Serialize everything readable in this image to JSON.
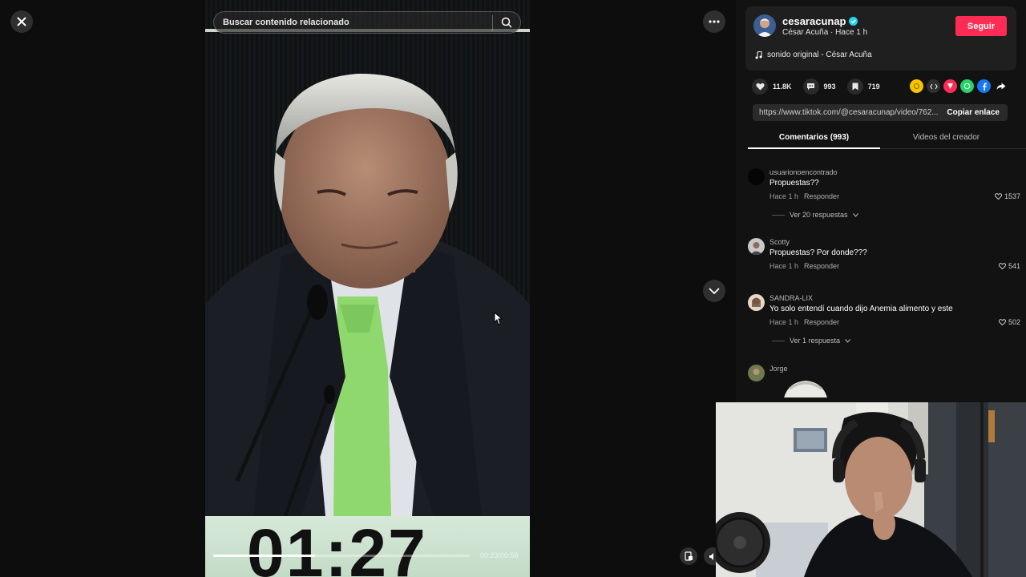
{
  "viewer": {
    "close_icon": "close-icon",
    "more_icon": "more-options-icon",
    "search_placeholder": "Buscar contenido relacionado",
    "scoreboard_time": "01:27",
    "playback_time": "00:23/00:58",
    "progress": 0.397
  },
  "author": {
    "handle": "cesaracunap",
    "display_name": "César Acuña",
    "posted_ago": "Hace 1 h",
    "follow_label": "Seguir",
    "music": "sonido original - César Acuña"
  },
  "actions": {
    "likes": "11.8K",
    "comments": "993",
    "saves": "719"
  },
  "link": {
    "url": "https://www.tiktok.com/@cesaracunap/video/762...",
    "copy_label": "Copiar enlace"
  },
  "tabs": [
    {
      "label": "Comentarios (993)"
    },
    {
      "label": "Videos del creador"
    }
  ],
  "comments": [
    {
      "user": "usuarionoencontrado",
      "text": "Propuestas??",
      "time": "Hace 1 h",
      "reply": "Responder",
      "likes": "1537",
      "more": "Ver 20 respuestas"
    },
    {
      "user": "Scotty",
      "text": "Propuestas? Por donde???",
      "time": "Hace 1 h",
      "reply": "Responder",
      "likes": "541"
    },
    {
      "user": "SANDRA-LIX",
      "text": "Yo solo entendí cuando dijo Anemia alimento y este",
      "time": "Hace 1 h",
      "reply": "Responder",
      "likes": "502",
      "more": "Ver 1 respuesta"
    },
    {
      "user": "Jorge"
    }
  ],
  "colors": {
    "accent": "#fe2c55",
    "panel_bg": "#121212",
    "verified": "#20d5ec"
  }
}
